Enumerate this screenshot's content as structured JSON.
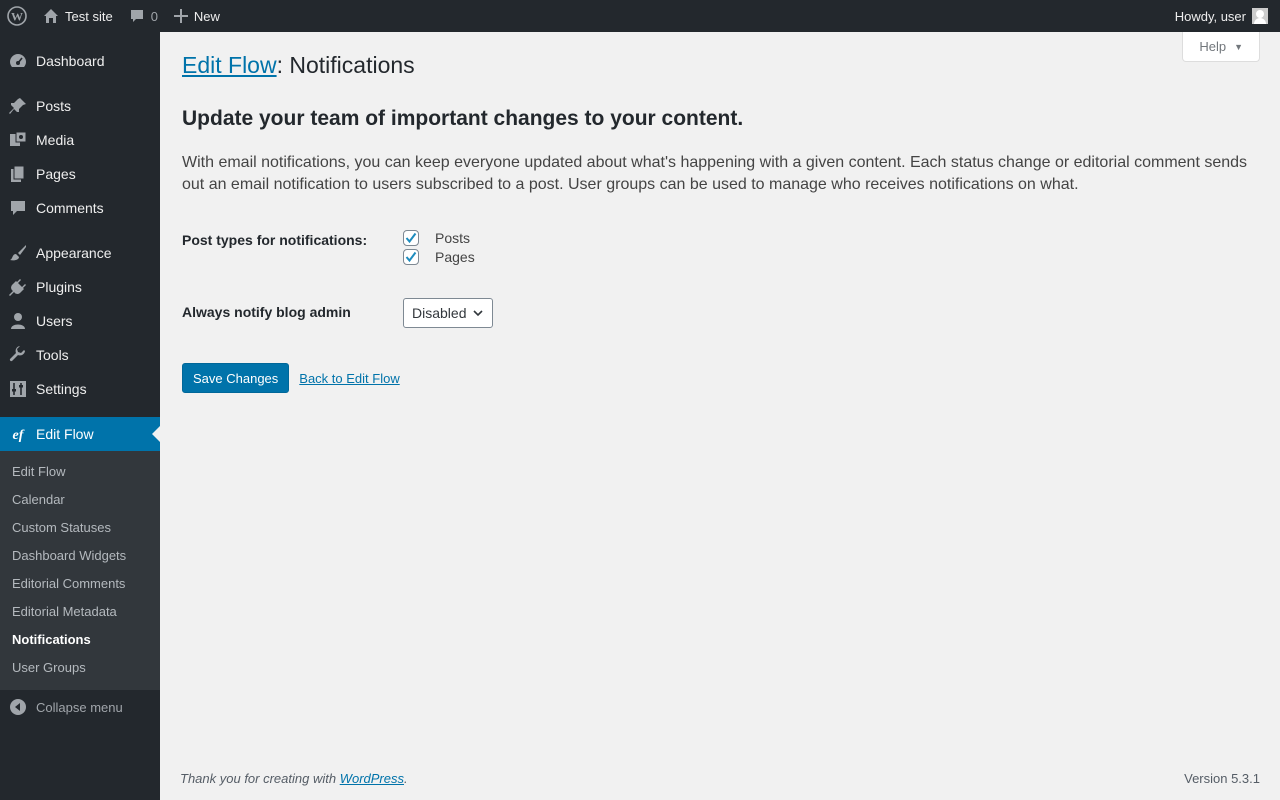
{
  "admin_bar": {
    "site_name": "Test site",
    "comment_count": "0",
    "new_label": "New",
    "greeting": "Howdy, user"
  },
  "sidebar": {
    "items": [
      {
        "label": "Dashboard",
        "icon": "dashboard-icon"
      },
      {
        "label": "Posts",
        "icon": "pushpin-icon"
      },
      {
        "label": "Media",
        "icon": "media-icon"
      },
      {
        "label": "Pages",
        "icon": "pages-icon"
      },
      {
        "label": "Comments",
        "icon": "comments-icon"
      },
      {
        "label": "Appearance",
        "icon": "brush-icon"
      },
      {
        "label": "Plugins",
        "icon": "plugin-icon"
      },
      {
        "label": "Users",
        "icon": "user-icon"
      },
      {
        "label": "Tools",
        "icon": "wrench-icon"
      },
      {
        "label": "Settings",
        "icon": "settings-icon"
      },
      {
        "label": "Edit Flow",
        "icon": "edit-flow-icon"
      }
    ],
    "submenu": [
      "Edit Flow",
      "Calendar",
      "Custom Statuses",
      "Dashboard Widgets",
      "Editorial Comments",
      "Editorial Metadata",
      "Notifications",
      "User Groups"
    ],
    "collapse_label": "Collapse menu"
  },
  "help": {
    "label": "Help"
  },
  "page": {
    "title_link": "Edit Flow",
    "title_rest": ": Notifications",
    "heading": "Update your team of important changes to your content.",
    "description": "With email notifications, you can keep everyone updated about what's happening with a given content. Each status change or editorial comment sends out an email notification to users subscribed to a post. User groups can be used to manage who receives notifications on what."
  },
  "form": {
    "post_types_label": "Post types for notifications:",
    "post_types": [
      {
        "label": "Posts",
        "checked": true
      },
      {
        "label": "Pages",
        "checked": true
      }
    ],
    "notify_admin_label": "Always notify blog admin",
    "notify_admin_value": "Disabled",
    "save_label": "Save Changes",
    "back_label": "Back to Edit Flow"
  },
  "footer": {
    "thanks_prefix": "Thank you for creating with ",
    "thanks_link": "WordPress",
    "thanks_suffix": ".",
    "version": "Version 5.3.1"
  },
  "colors": {
    "accent": "#0073aa",
    "sidebar_bg": "#23282d",
    "submenu_bg": "#32373c",
    "page_bg": "#f1f1f1"
  }
}
